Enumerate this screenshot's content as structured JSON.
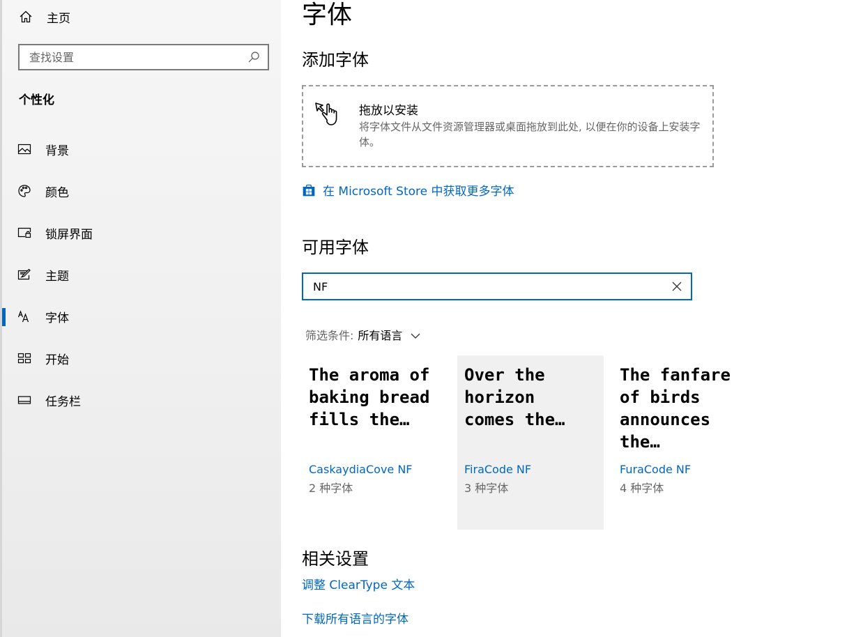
{
  "sidebar": {
    "home_label": "主页",
    "search_placeholder": "查找设置",
    "section_title": "个性化",
    "items": [
      {
        "label": "背景",
        "icon": "picture-icon"
      },
      {
        "label": "颜色",
        "icon": "palette-icon"
      },
      {
        "label": "锁屏界面",
        "icon": "lock-screen-icon"
      },
      {
        "label": "主题",
        "icon": "theme-icon"
      },
      {
        "label": "字体",
        "icon": "font-icon",
        "active": true
      },
      {
        "label": "开始",
        "icon": "start-icon"
      },
      {
        "label": "任务栏",
        "icon": "taskbar-icon"
      }
    ]
  },
  "main": {
    "title": "字体",
    "add_fonts": {
      "heading": "添加字体",
      "drop_title": "拖放以安装",
      "drop_desc": "将字体文件从文件资源管理器或桌面拖放到此处, 以便在你的设备上安装字体。",
      "store_link": "在 Microsoft Store 中获取更多字体"
    },
    "available": {
      "heading": "可用字体",
      "search_value": "NF",
      "filter_label": "筛选条件:",
      "filter_value": "所有语言"
    },
    "fonts": [
      {
        "preview": "The aroma of\nbaking bread\nfills the…",
        "name": "CaskaydiaCove NF",
        "count": "2 种字体"
      },
      {
        "preview": "Over the\nhorizon\ncomes the…",
        "name": "FiraCode NF",
        "count": "3 种字体"
      },
      {
        "preview": "The fanfare\nof birds\nannounces\nthe…",
        "name": "FuraCode NF",
        "count": "4 种字体"
      }
    ],
    "related": {
      "heading": "相关设置",
      "links": [
        "调整 ClearType 文本",
        "下载所有语言的字体"
      ]
    }
  },
  "colors": {
    "accent": "#0067c0",
    "sidebar_bg": "#f0f0f0",
    "selected_card_bg": "#f0f0f0"
  }
}
